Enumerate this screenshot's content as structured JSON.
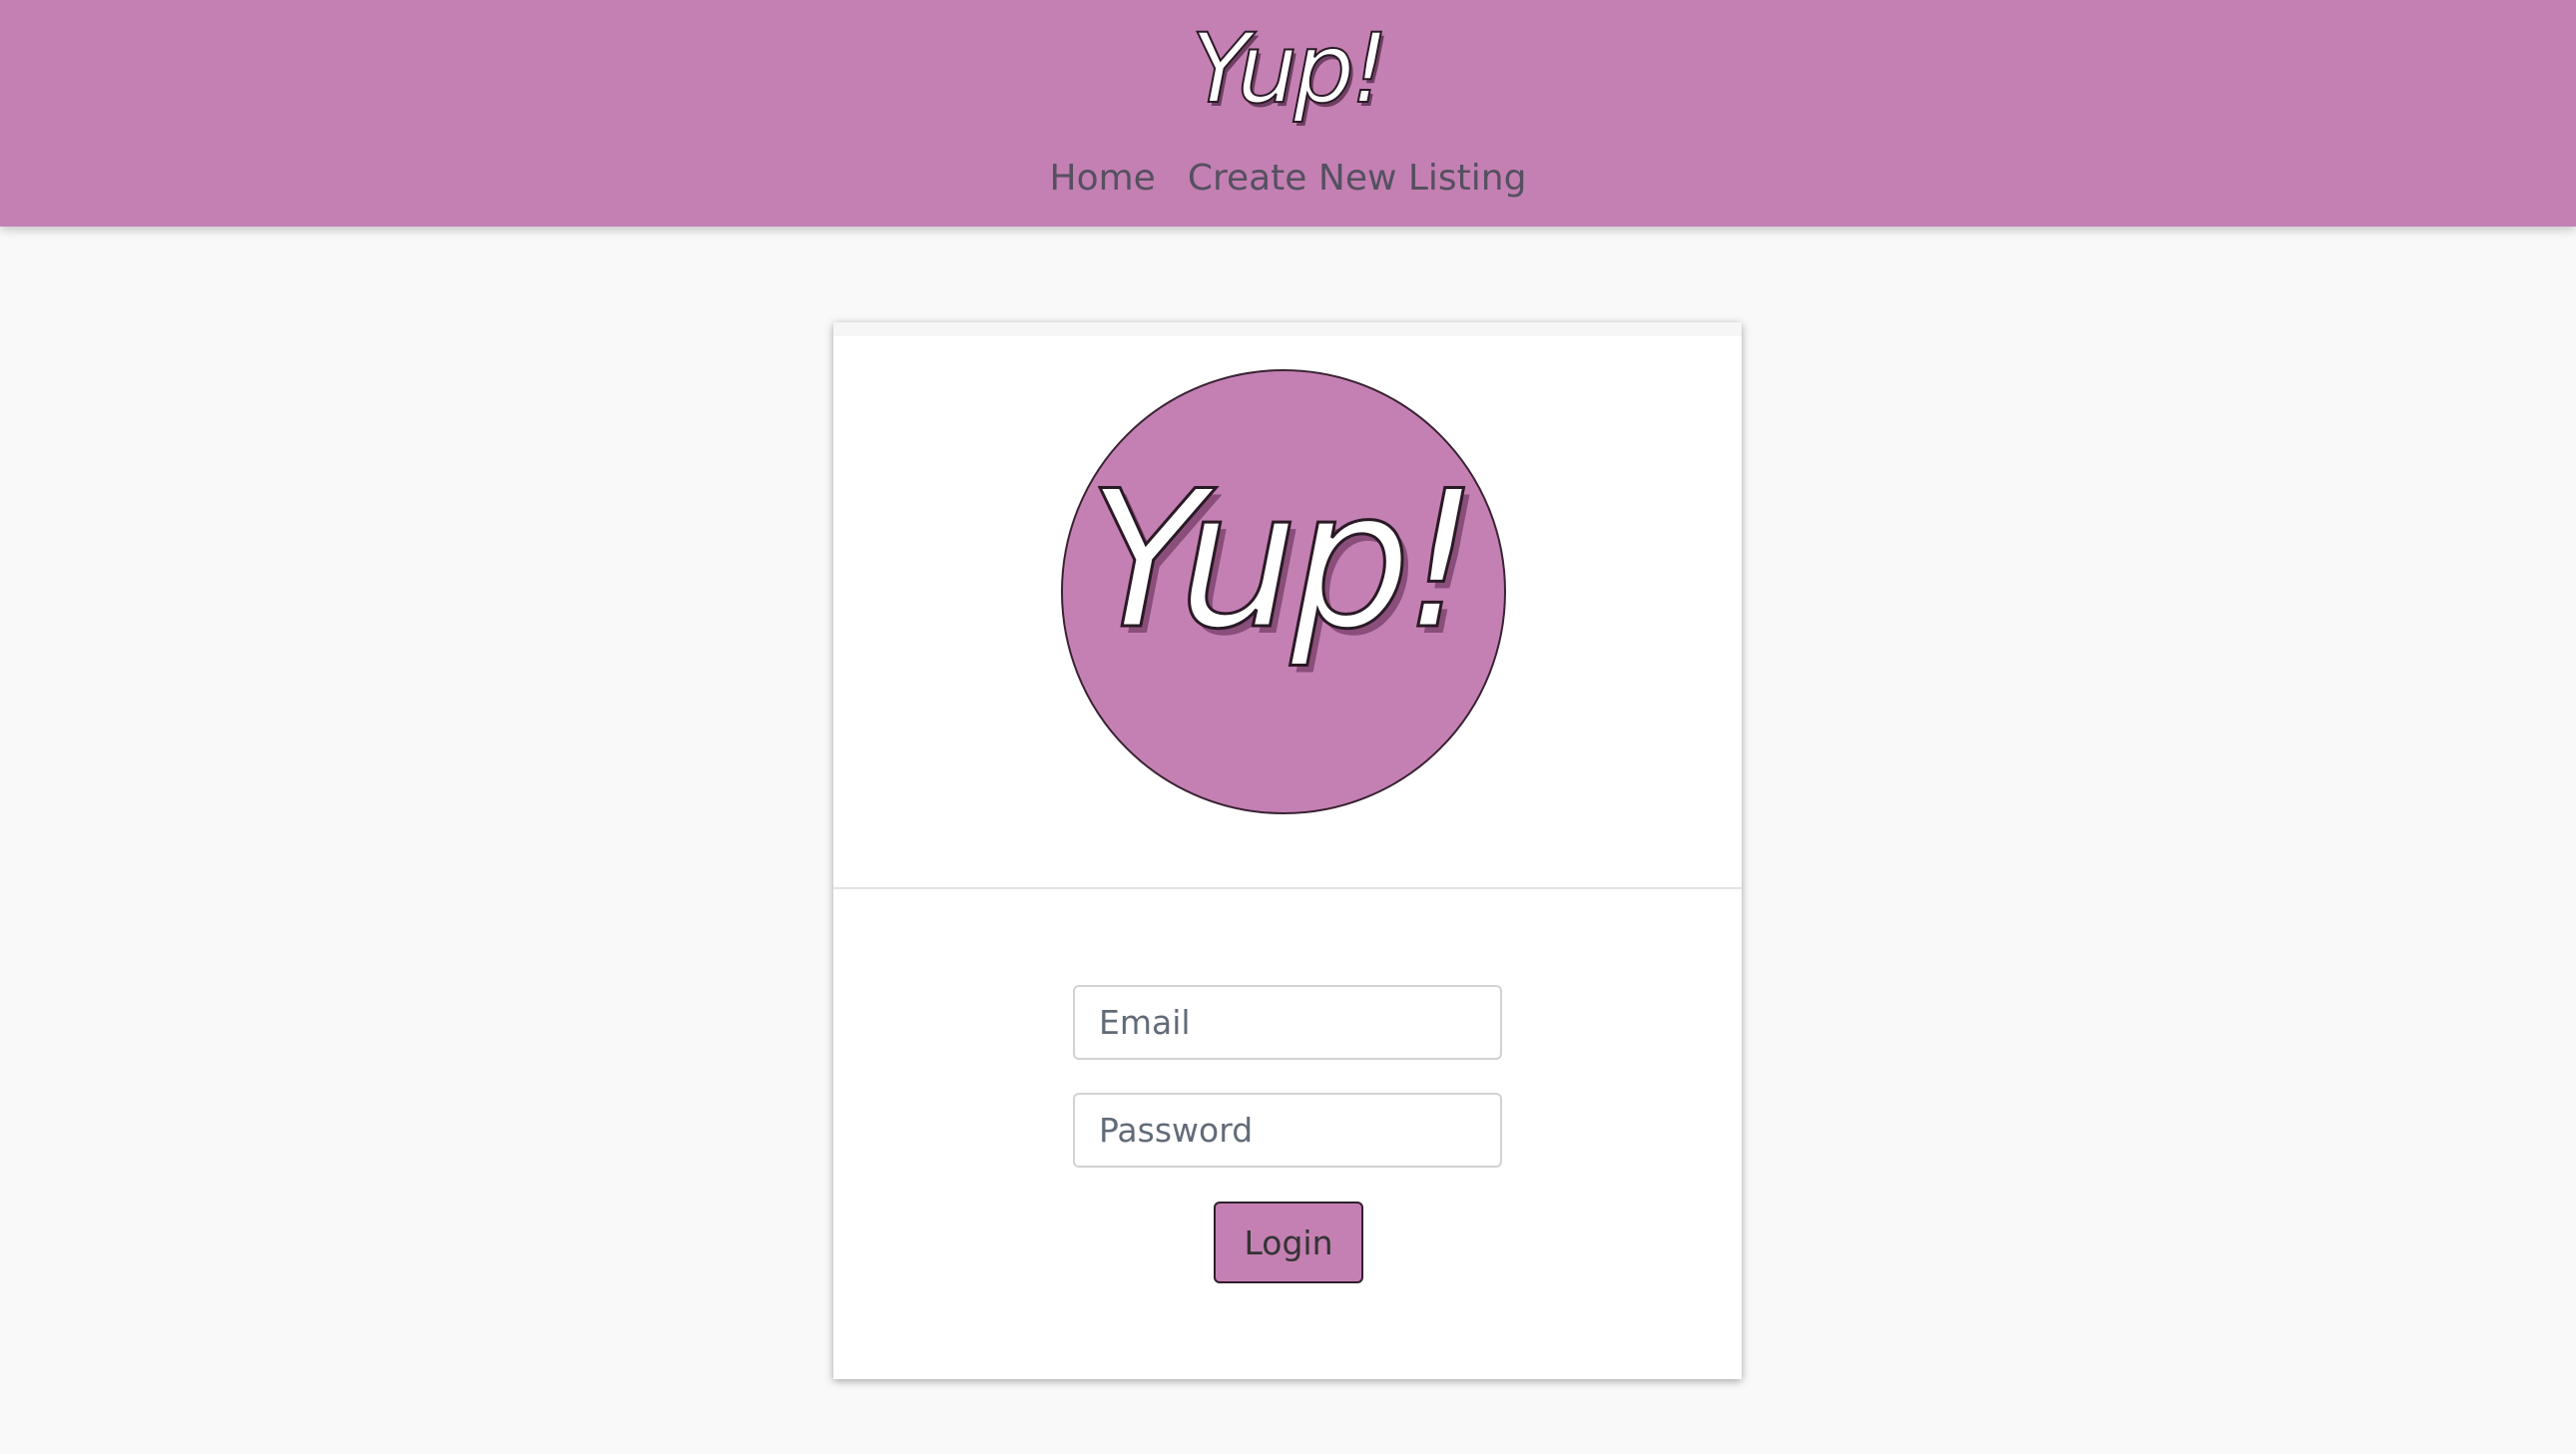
{
  "header": {
    "logo_text": "Yup!",
    "nav": [
      {
        "label": "Home"
      },
      {
        "label": "Create New Listing"
      }
    ]
  },
  "login_card": {
    "logo_text": "Yup!",
    "email": {
      "placeholder": "Email",
      "value": ""
    },
    "password": {
      "placeholder": "Password",
      "value": ""
    },
    "login_label": "Login"
  },
  "colors": {
    "brand": "#c480b3",
    "background": "#f9f9f9",
    "nav_text": "#555060"
  }
}
